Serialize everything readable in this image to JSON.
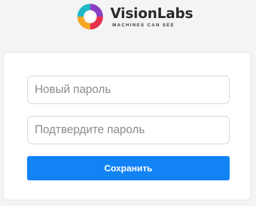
{
  "brand": {
    "name": "VisionLabs",
    "tagline": "MACHINES CAN SEE"
  },
  "form": {
    "new_password_placeholder": "Новый пароль",
    "confirm_password_placeholder": "Подтвердите пароль",
    "save_label": "Сохранить"
  },
  "colors": {
    "accent": "#1283f5",
    "background": "#f4f4f4",
    "card": "#ffffff"
  },
  "icons": {
    "logo": "visionlabs-logo-icon"
  }
}
